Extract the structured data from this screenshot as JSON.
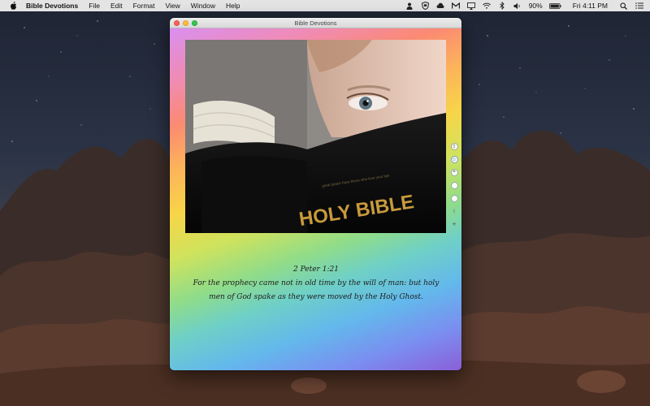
{
  "menubar": {
    "app_name": "Bible Devotions",
    "menus": [
      "File",
      "Edit",
      "Format",
      "View",
      "Window",
      "Help"
    ],
    "battery": "90%",
    "clock": "Fri 4:11 PM",
    "status_icons": [
      "user-icon",
      "shield-icon",
      "cloud-icon",
      "mail-icon",
      "airplay-icon",
      "wifi-icon",
      "bluetooth-icon",
      "volume-icon",
      "battery-icon",
      "search-icon",
      "list-icon"
    ]
  },
  "window": {
    "title": "Bible Devotions"
  },
  "photo": {
    "book_title": "HOLY BIBLE",
    "book_subtitle": "great peace have those who love your law"
  },
  "side_tools": [
    "share-icon",
    "settings-icon",
    "speech-icon",
    "circle-icon",
    "circle-icon",
    "pin-icon",
    "sparkle-icon"
  ],
  "verse": {
    "reference": "2 Peter 1:21",
    "text": "For the prophecy came not in old time by the will of man: but holy men of God spake as they were moved by the Holy Ghost."
  },
  "colors": {
    "gradient_top": "#d98ff0",
    "gradient_mid": "#f7d548",
    "gradient_bottom": "#8b5fd8"
  }
}
